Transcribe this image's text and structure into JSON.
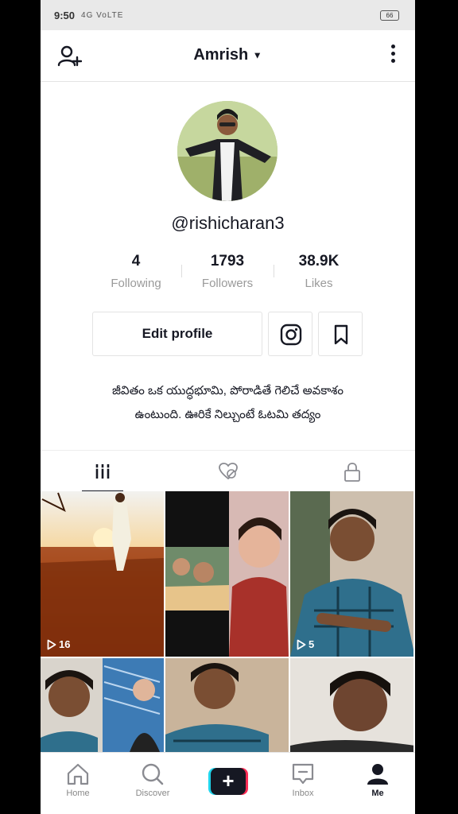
{
  "status_bar": {
    "time": "9:50",
    "signal": "4G VoLTE",
    "battery": "66"
  },
  "header": {
    "title": "Amrish"
  },
  "profile": {
    "username": "@rishicharan3",
    "stats": [
      {
        "value": "4",
        "label": "Following"
      },
      {
        "value": "1793",
        "label": "Followers"
      },
      {
        "value": "38.9K",
        "label": "Likes"
      }
    ],
    "edit_label": "Edit profile",
    "bio_line1": "జీవితం ఒక యుద్ధభూమి, పోరాడితే గెలిచే అవకాశం",
    "bio_line2": "ఉంటుంది. ఊరికే నిల్చుంటే ఓటమి తద్యం"
  },
  "videos": [
    {
      "views": "16"
    },
    {
      "views": ""
    },
    {
      "views": "5"
    }
  ],
  "nav": {
    "home": "Home",
    "discover": "Discover",
    "inbox": "Inbox",
    "me": "Me"
  },
  "colors": {
    "accent_red": "#fe2c55",
    "accent_cyan": "#20d5ec",
    "text": "#161823"
  }
}
